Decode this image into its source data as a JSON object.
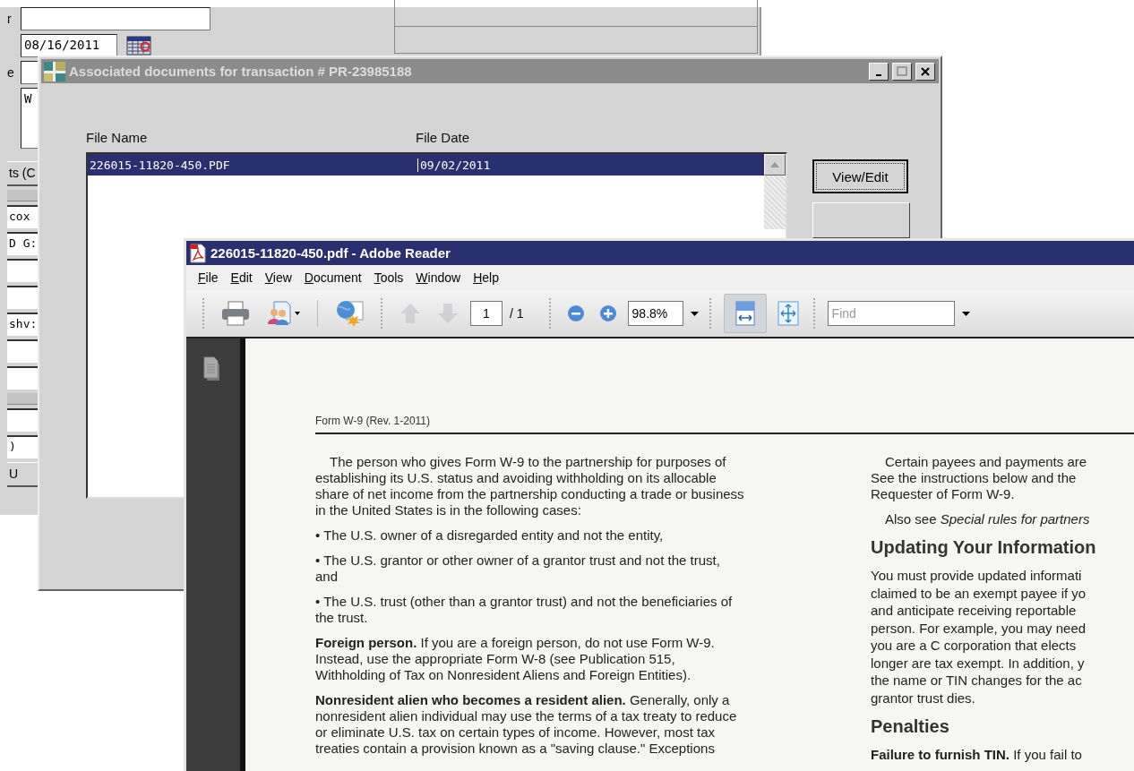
{
  "background_window": {
    "form_rows": [
      {
        "kind": "text",
        "label": "r"
      },
      {
        "kind": "date",
        "value": "08/16/2011"
      },
      {
        "kind": "small",
        "label": "e"
      },
      {
        "kind": "memo",
        "value": "W"
      }
    ],
    "side_strip": [
      {
        "kind": "button",
        "text": "ts (C"
      },
      {
        "kind": "bar"
      },
      {
        "kind": "field",
        "text": "cox"
      },
      {
        "kind": "field",
        "text": "D G:"
      },
      {
        "kind": "field"
      },
      {
        "kind": "field"
      },
      {
        "kind": "field",
        "text": "shv:"
      },
      {
        "kind": "field"
      },
      {
        "kind": "field"
      },
      {
        "kind": "bar"
      },
      {
        "kind": "field"
      },
      {
        "kind": "field",
        "text": ")"
      },
      {
        "kind": "button",
        "text": "U"
      }
    ]
  },
  "dialog": {
    "title": "Associated documents for transaction # PR-23985188",
    "active": false,
    "columns": [
      "File Name",
      "File Date"
    ],
    "rows": [
      {
        "cells": [
          "226015-11820-450.PDF",
          "09/02/2011"
        ],
        "selected": true
      }
    ],
    "buttons": [
      "View/Edit"
    ]
  },
  "reader": {
    "title": "226015-11820-450.pdf - Adobe Reader",
    "active": true,
    "menu": [
      "File",
      "Edit",
      "View",
      "Document",
      "Tools",
      "Window",
      "Help"
    ],
    "toolbar": {
      "page": "1",
      "page_count": "/ 1",
      "zoom": "98.8%",
      "find_placeholder": "Find",
      "prev_disabled": true,
      "next_disabled": true,
      "fit_width_selected": true,
      "fit_page_selected": false
    },
    "document": {
      "header": "Form W-9 (Rev. 1-2011)",
      "left_column": [
        {
          "kind": "lead",
          "lines": [
            "The person who gives Form W-9 to the partnership for purposes of",
            "establishing its U.S. status and avoiding withholding on its allocable",
            "share of net income from the partnership conducting a trade or business",
            "in the United States is in the following cases:"
          ]
        },
        {
          "kind": "body",
          "lines": [
            "• The U.S. owner of a disregarded entity and not the entity,"
          ]
        },
        {
          "kind": "body",
          "lines": [
            "• The U.S. grantor or other owner of a grantor trust and not the trust,",
            "and"
          ]
        },
        {
          "kind": "body",
          "lines": [
            "• The U.S. trust (other than a grantor trust) and not the beneficiaries of",
            "the trust."
          ]
        },
        {
          "kind": "body",
          "lines": [
            "**Foreign person.** If you are a foreign person, do not use Form W-9.",
            "Instead, use the appropriate Form W-8 (see Publication 515,",
            "Withholding of Tax on Nonresident Aliens and Foreign Entities)."
          ]
        },
        {
          "kind": "body",
          "lines": [
            "**Nonresident alien who becomes a resident alien.** Generally, only a",
            "nonresident alien individual may use the terms of a tax treaty to reduce",
            "or eliminate U.S. tax on certain types of income. However, most tax",
            "treaties contain a provision known as a \"saving clause.\" Exceptions"
          ]
        }
      ],
      "right_column": [
        {
          "kind": "lead",
          "lines": [
            "Certain payees and payments are",
            "See the instructions below and the",
            "Requester of Form W-9."
          ]
        },
        {
          "kind": "lead",
          "lines": [
            "Also see *Special rules for partners*"
          ]
        },
        {
          "kind": "heading",
          "lines": [
            "Updating Your Information"
          ]
        },
        {
          "kind": "body",
          "lines": [
            "You must provide updated informati",
            "claimed to be an exempt payee if yo",
            "and anticipate receiving reportable",
            "person. For example, you may need",
            "you are a C corporation that elects",
            "longer are tax exempt. In addition, y",
            "the name or TIN changes for the ac",
            "grantor trust dies."
          ]
        },
        {
          "kind": "heading",
          "lines": [
            "Penalties"
          ]
        },
        {
          "kind": "body",
          "lines": [
            "**Failure to furnish TIN.** If you fail to"
          ]
        }
      ]
    }
  }
}
